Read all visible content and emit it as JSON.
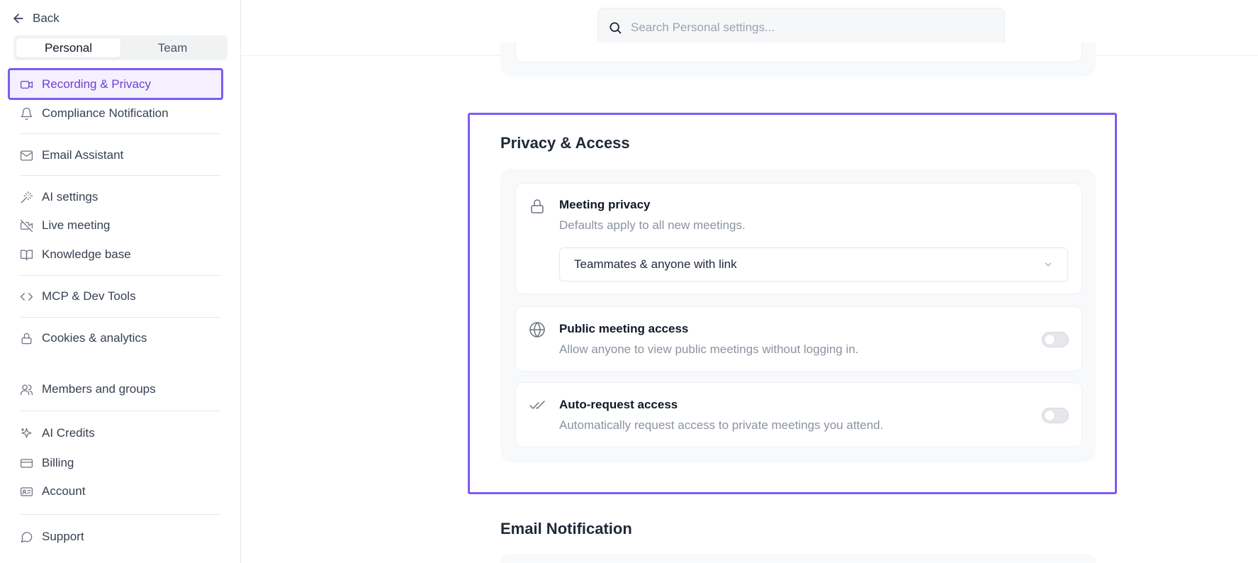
{
  "sidebar": {
    "back_label": "Back",
    "tabs": [
      "Personal",
      "Team"
    ],
    "active_tab": "Personal",
    "items": [
      {
        "label": "Recording & Privacy",
        "icon": "video-icon",
        "active": true
      },
      {
        "label": "Compliance Notification",
        "icon": "bell-icon"
      },
      {
        "label": "Email Assistant",
        "icon": "mail-icon"
      },
      {
        "label": "AI settings",
        "icon": "magic-wand-icon"
      },
      {
        "label": "Live meeting",
        "icon": "video-off-icon"
      },
      {
        "label": "Knowledge base",
        "icon": "book-icon"
      },
      {
        "label": "MCP & Dev Tools",
        "icon": "code-icon"
      },
      {
        "label": "Cookies & analytics",
        "icon": "lock-icon"
      },
      {
        "label": "Members and groups",
        "icon": "users-icon"
      },
      {
        "label": "AI Credits",
        "icon": "sparkle-icon"
      },
      {
        "label": "Billing",
        "icon": "credit-card-icon"
      },
      {
        "label": "Account",
        "icon": "id-card-icon"
      },
      {
        "label": "Support",
        "icon": "chat-icon"
      }
    ]
  },
  "search": {
    "placeholder": "Search Personal settings..."
  },
  "main": {
    "privacy_section": {
      "title": "Privacy & Access",
      "meeting_privacy": {
        "title": "Meeting privacy",
        "description": "Defaults apply to all new meetings.",
        "selected_value": "Teammates & anyone with link"
      },
      "public_access": {
        "title": "Public meeting access",
        "description": "Allow anyone to view public meetings without logging in.",
        "enabled": false
      },
      "auto_request": {
        "title": "Auto-request access",
        "description": "Automatically request access to private meetings you attend.",
        "enabled": false
      }
    },
    "email_section": {
      "title": "Email Notification"
    }
  },
  "colors": {
    "accent": "#7c5cf0",
    "active_text": "#6d3fd8"
  }
}
